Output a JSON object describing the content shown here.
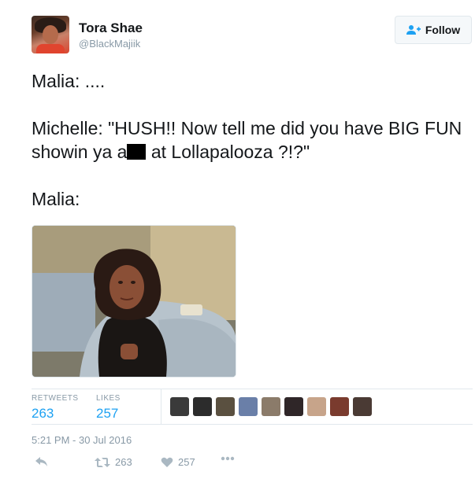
{
  "tweet": {
    "user": {
      "name": "Tora Shae",
      "handle": "@BlackMajiik"
    },
    "follow_label": "Follow",
    "lines": {
      "line1": "Malia: ....",
      "line2_part1": "Michelle: \"HUSH!! Now tell me did you have BIG FUN showin ya a",
      "line2_part2": " at Lollapalooza ?!?\"",
      "line3": "Malia:"
    },
    "stats": {
      "retweets_label": "RETWEETS",
      "retweets_value": "263",
      "likes_label": "LIKES",
      "likes_value": "257"
    },
    "timestamp": "5:21 PM - 30 Jul 2016",
    "actions": {
      "retweet_count": "263",
      "like_count": "257"
    }
  },
  "colors": {
    "accent": "#1da1f2",
    "muted": "#8899a6",
    "border": "#e1e8ed"
  },
  "icons": [
    "follow-person-icon",
    "reply-icon",
    "retweet-icon",
    "heart-icon",
    "more-icon"
  ]
}
